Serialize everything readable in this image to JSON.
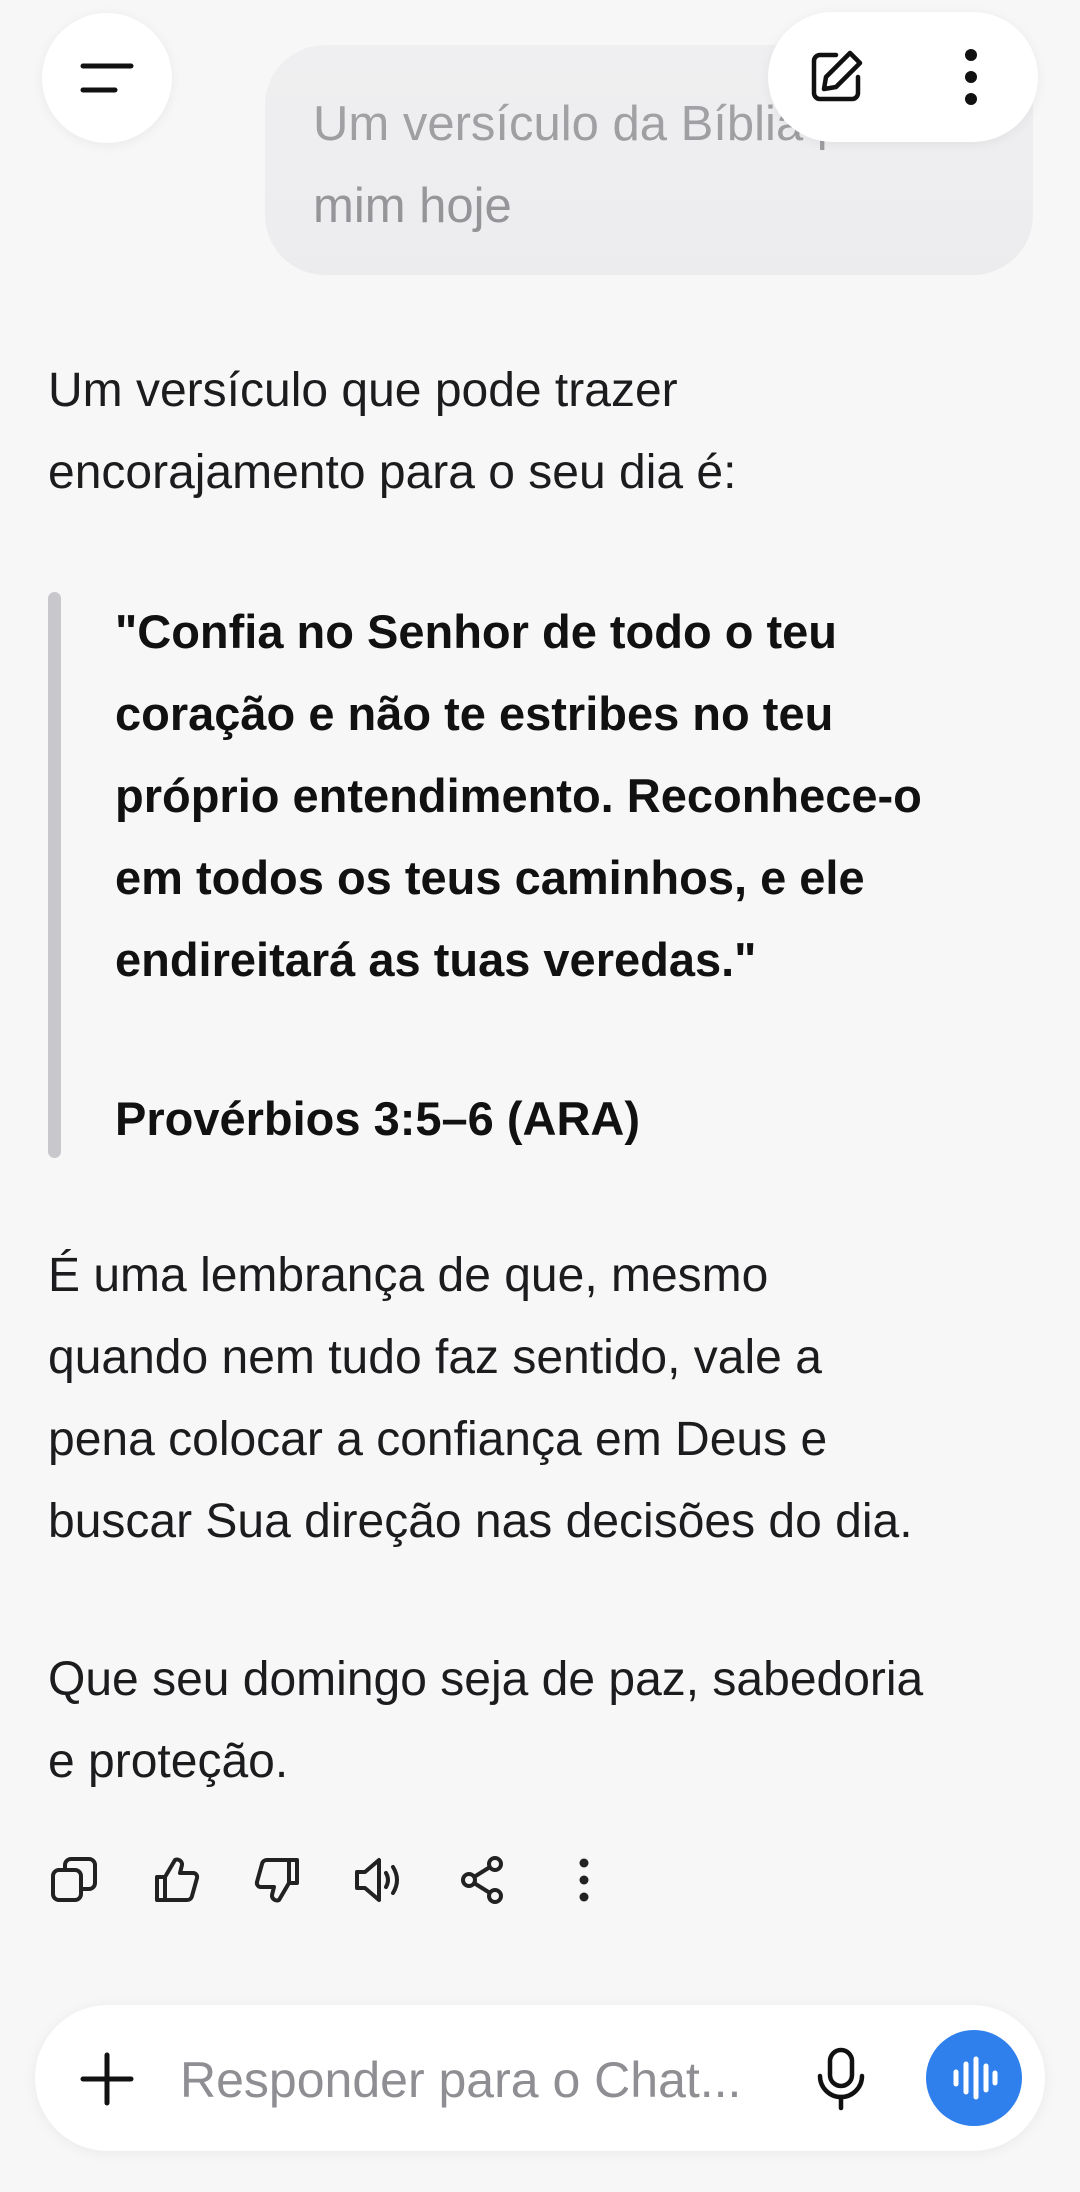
{
  "user_message": {
    "line1": "Um versículo da Bíblia para",
    "line2": "mim hoje"
  },
  "assistant": {
    "intro_line1": "Um versículo que pode trazer",
    "intro_line2": "encorajamento para o seu dia é:",
    "quote_lines": [
      "\"Confia no Senhor de todo o teu",
      "coração e não te estribes no teu",
      "próprio entendimento. Reconhece-o",
      "em todos os teus caminhos, e ele",
      "endireitará as tuas veredas.\""
    ],
    "quote_reference": "Provérbios 3:5–6 (ARA)",
    "reflection_lines": [
      "É uma lembrança de que, mesmo",
      "quando nem tudo faz sentido, vale a",
      "pena colocar a confiança em Deus e",
      "buscar Sua direção nas decisões do dia."
    ],
    "closing_lines": [
      "Que seu domingo seja de paz, sabedoria",
      "e proteção."
    ]
  },
  "icons": {
    "menu": "menu-icon",
    "new_chat": "edit-icon",
    "more_top": "more-vertical-icon",
    "copy": "copy-icon",
    "thumbs_up": "thumbs-up-icon",
    "thumbs_down": "thumbs-down-icon",
    "read_aloud": "speaker-icon",
    "share": "share-icon",
    "more_actions": "more-vertical-icon",
    "attach": "plus-icon",
    "mic": "microphone-icon",
    "voice": "voice-waveform-icon"
  },
  "composer": {
    "placeholder": "Responder para o Chat..."
  },
  "colors": {
    "background": "#f7f7f8",
    "user_bubble": "#ececee",
    "accent_voice": "#2f80ed",
    "quote_bar": "#c8c8cc"
  }
}
